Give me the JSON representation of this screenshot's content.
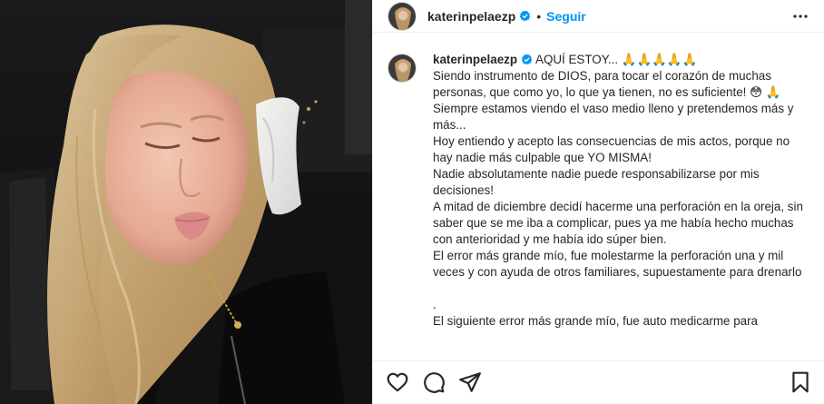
{
  "post": {
    "username": "katerinpelaezp",
    "follow_label": "Seguir",
    "dot": "•",
    "caption_lines": [
      "AQUÍ ESTOY... 🙏🙏🙏🙏🙏",
      "Siendo instrumento de DIOS, para tocar el corazón de muchas personas, que como yo, lo que ya tienen, no es suficiente! 😳 🙏",
      "Siempre estamos viendo el vaso medio lleno y pretendemos más y más...",
      "Hoy entiendo y acepto las consecuencias de mis actos, porque no hay nadie más culpable que YO MISMA!",
      "Nadie absolutamente nadie puede responsabilizarse por mis decisiones!",
      "A mitad de diciembre decidí hacerme una perforación en la oreja, sin saber que se me iba a complicar, pues ya me había hecho muchas con anterioridad y me había ido súper bien.",
      "El error más grande mío, fue molestarme la perforación una y mil veces y con ayuda de otros familiares, supuestamente para drenarlo",
      "",
      ".",
      "El siguiente error más grande mío, fue auto medicarme para"
    ]
  },
  "icons": {
    "verified": "verified-badge-icon",
    "more": "more-options-icon",
    "like": "heart-icon",
    "comment": "comment-icon",
    "share": "share-icon",
    "save": "bookmark-icon"
  },
  "colors": {
    "link_blue": "#0095f6",
    "verified_blue": "#0095f6",
    "text": "#262626"
  }
}
